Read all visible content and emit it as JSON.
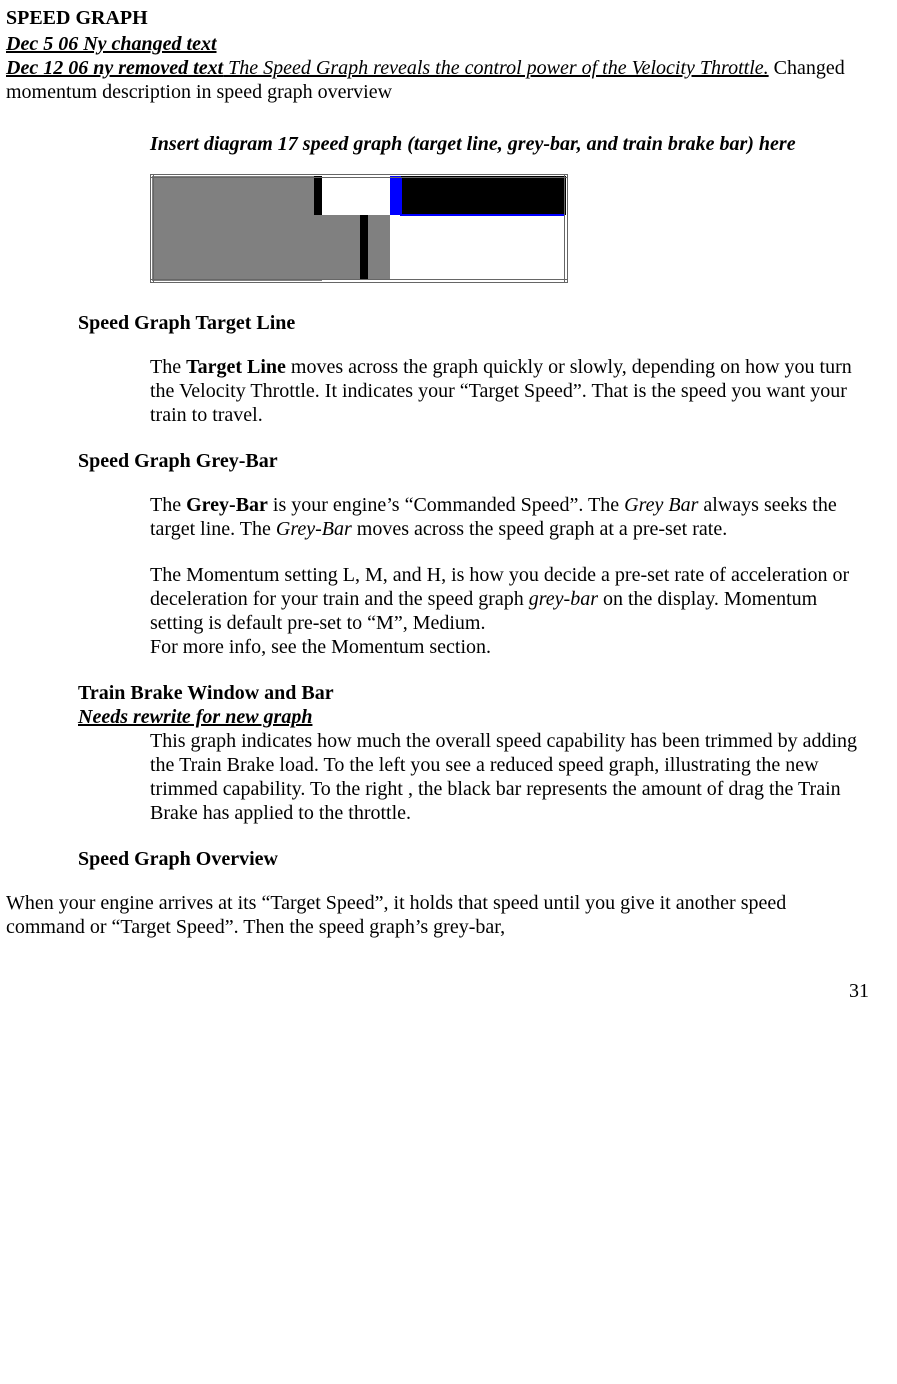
{
  "title": "SPEED GRAPH",
  "rev1": "Dec 5 06 Ny changed text",
  "rev2_lead": "Dec 12 06 ny removed text",
  "rev2_struck": " The Speed Graph reveals the control power of the Velocity Throttle.",
  "rev2_tail": " Changed momentum description in speed graph overview",
  "insert_note": "Insert diagram 17 speed graph (target line, grey-bar, and train brake bar) here",
  "sections": {
    "target_line": {
      "heading": "Speed Graph Target Line",
      "p1_a": "The ",
      "p1_b": "Target Line",
      "p1_c": " moves across the graph quickly or slowly, depending on how you turn the Velocity Throttle. It indicates your “Target Speed”. That is the speed you want your train to travel."
    },
    "grey_bar": {
      "heading": "Speed Graph Grey-Bar",
      "p1_a": "The ",
      "p1_b": "Grey-Bar",
      "p1_c": " is your engine’s “Commanded Speed”. The ",
      "p1_d": "Grey Bar",
      "p1_e": " always seeks the target line.  The ",
      "p1_f": "Grey-Bar",
      "p1_g": " moves across the speed graph at a pre-set rate.",
      "p2_a": "The Momentum setting L, M, and H, is how you decide a pre-set rate of acceleration or deceleration for your train and the speed graph ",
      "p2_b": "grey-bar",
      "p2_c": " on the display. Momentum setting is default pre-set to “M”, Medium.",
      "p2_d": "For more info, see the Momentum section."
    },
    "train_brake": {
      "heading": "Train Brake Window and Bar",
      "note": "Needs rewrite for new graph",
      "p1": "This graph indicates how much the overall speed capability has been trimmed by adding the Train Brake load. To the left you see a reduced speed graph, illustrating the new trimmed capability. To the right , the black bar represents the amount of drag the Train Brake has applied to the throttle."
    },
    "overview": {
      "heading": "Speed Graph Overview",
      "p1": "When your engine arrives at its “Target Speed”, it holds that speed until you give it another speed command or “Target Speed”. Then the speed graph’s grey-bar,"
    }
  },
  "page_number": "31"
}
